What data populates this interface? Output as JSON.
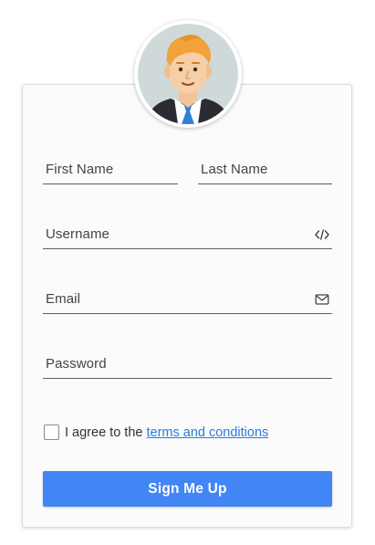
{
  "form": {
    "avatar_icon": "user-avatar-icon",
    "first_name": {
      "placeholder": "First Name"
    },
    "last_name": {
      "placeholder": "Last Name"
    },
    "username": {
      "placeholder": "Username",
      "icon": "code-icon"
    },
    "email": {
      "placeholder": "Email",
      "icon": "envelope-icon"
    },
    "password": {
      "placeholder": "Password"
    },
    "agree": {
      "prefix": "I agree to the ",
      "link_text": "terms and conditions",
      "checked": false
    },
    "submit_label": "Sign Me Up"
  },
  "colors": {
    "accent": "#4285f4",
    "link": "#2b7ae0",
    "underline": "#5f5f5f"
  }
}
